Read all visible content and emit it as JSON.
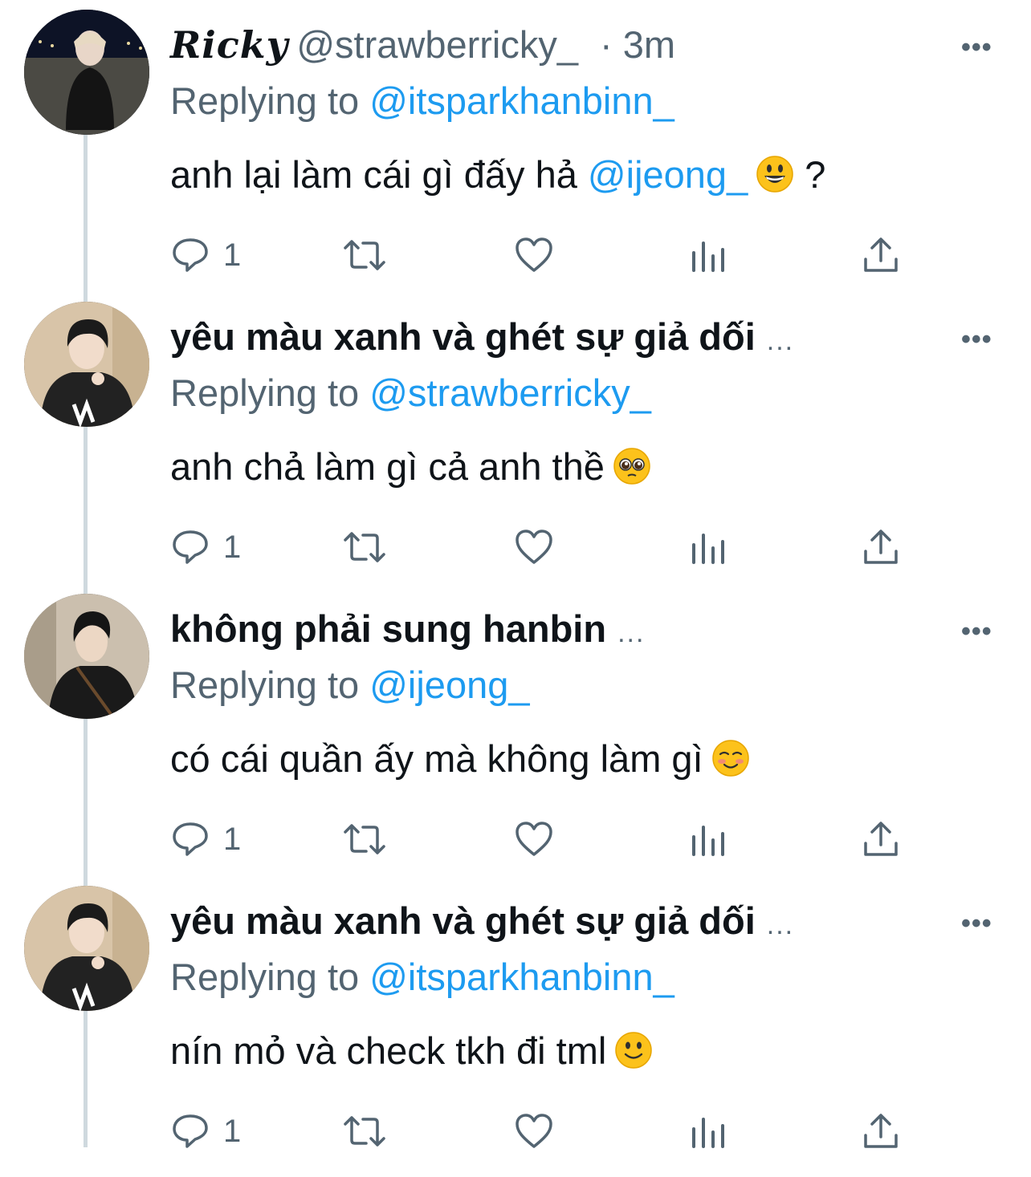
{
  "colors": {
    "link": "#1d9bf0",
    "secondary": "#536471",
    "text": "#0f1419",
    "thread": "#cfd9de"
  },
  "tweets": [
    {
      "name": "Ricky",
      "handle": "@strawberricky_",
      "time": "· 3m",
      "replying_label": "Replying to ",
      "replying_to": "@itsparkhanbinn_",
      "text": "anh lại làm cái gì đấy hả ",
      "text_mention": "@ijeong_",
      "text_suffix": " ?",
      "emoji": "grinning-face",
      "reply_count": "1",
      "more": "•••"
    },
    {
      "name": "yêu màu xanh và ghét sự giả dối",
      "truncation": "...",
      "replying_label": "Replying to ",
      "replying_to": "@strawberricky_",
      "text": "anh chả làm gì cả anh thề",
      "emoji": "pleading-face",
      "reply_count": "1",
      "more": "•••"
    },
    {
      "name": "không phải sung hanbin",
      "truncation": "...",
      "replying_label": "Replying to ",
      "replying_to": "@ijeong_",
      "text": "có cái quần ấy mà không làm gì",
      "emoji": "smiling-face",
      "reply_count": "1",
      "more": "•••"
    },
    {
      "name": "yêu màu xanh và ghét sự giả dối",
      "truncation": "...",
      "replying_label": "Replying to ",
      "replying_to": "@itsparkhanbinn_",
      "text": "nín mỏ và check tkh đi tml",
      "emoji": "slightly-smiling-face",
      "reply_count": "1",
      "more": "•••"
    }
  ]
}
